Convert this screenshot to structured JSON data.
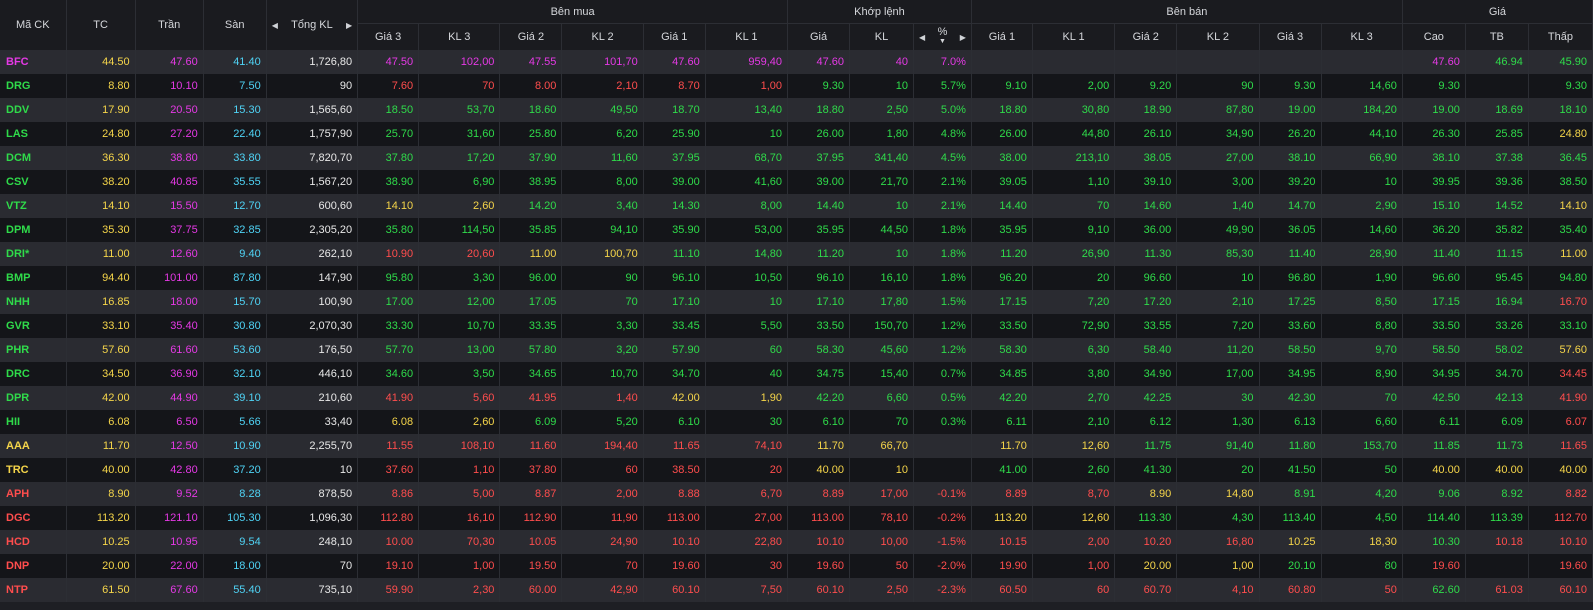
{
  "header": {
    "symbol": "Mã CK",
    "tc": "TC",
    "tran": "Trần",
    "san": "Sàn",
    "total": "Tổng KL",
    "buy_group": "Bên mua",
    "match_group": "Khớp lệnh",
    "sell_group": "Bên bán",
    "price_group": "Giá",
    "bid3_price": "Giá 3",
    "bid3_vol": "KL 3",
    "bid2_price": "Giá 2",
    "bid2_vol": "KL 2",
    "bid1_price": "Giá 1",
    "bid1_vol": "KL 1",
    "match_price": "Giá",
    "match_vol": "KL",
    "match_pct": "%",
    "ask1_price": "Giá 1",
    "ask1_vol": "KL 1",
    "ask2_price": "Giá 2",
    "ask2_vol": "KL 2",
    "ask3_price": "Giá 3",
    "ask3_vol": "KL 3",
    "high": "Cao",
    "avg": "TB",
    "low": "Thấp"
  },
  "colors": {
    "up": "#2fdb4a",
    "down": "#ff4d4d",
    "reference": "#f5d54a",
    "ceiling": "#e539e5",
    "floor": "#4fd3f5",
    "neutral": "#e8e8e8"
  },
  "rows": [
    {
      "c": [
        "ce",
        "ref",
        "ce",
        "fl",
        "wh",
        "ce",
        "ce",
        "ce",
        "ce",
        "ce",
        "ce",
        "ce",
        "ce",
        "ce",
        "",
        "",
        "",
        "",
        "",
        "",
        "ce",
        "up",
        "up"
      ],
      "v": [
        "BFC",
        "44.50",
        "47.60",
        "41.40",
        "1,726,80",
        "47.50",
        "102,00",
        "47.55",
        "101,70",
        "47.60",
        "959,40",
        "47.60",
        "40",
        "7.0%",
        "",
        "",
        "",
        "",
        "",
        "",
        "47.60",
        "46.94",
        "45.90"
      ]
    },
    {
      "c": [
        "up",
        "ref",
        "ce",
        "fl",
        "wh",
        "dn",
        "dn",
        "dn",
        "dn",
        "dn",
        "dn",
        "up",
        "up",
        "up",
        "up",
        "up",
        "up",
        "up",
        "up",
        "up",
        "up",
        "",
        "up"
      ],
      "v": [
        "DRG",
        "8.80",
        "10.10",
        "7.50",
        "90",
        "7.60",
        "70",
        "8.00",
        "2,10",
        "8.70",
        "1,00",
        "9.30",
        "10",
        "5.7%",
        "9.10",
        "2,00",
        "9.20",
        "90",
        "9.30",
        "14,60",
        "9.30",
        "",
        "9.30"
      ]
    },
    {
      "c": [
        "up",
        "ref",
        "ce",
        "fl",
        "wh",
        "up",
        "up",
        "up",
        "up",
        "up",
        "up",
        "up",
        "up",
        "up",
        "up",
        "up",
        "up",
        "up",
        "up",
        "up",
        "up",
        "up",
        "up"
      ],
      "v": [
        "DDV",
        "17.90",
        "20.50",
        "15.30",
        "1,565,60",
        "18.50",
        "53,70",
        "18.60",
        "49,50",
        "18.70",
        "13,40",
        "18.80",
        "2,50",
        "5.0%",
        "18.80",
        "30,80",
        "18.90",
        "87,80",
        "19.00",
        "184,20",
        "19.00",
        "18.69",
        "18.10"
      ]
    },
    {
      "c": [
        "up",
        "ref",
        "ce",
        "fl",
        "wh",
        "up",
        "up",
        "up",
        "up",
        "up",
        "up",
        "up",
        "up",
        "up",
        "up",
        "up",
        "up",
        "up",
        "up",
        "up",
        "up",
        "up",
        "ref"
      ],
      "v": [
        "LAS",
        "24.80",
        "27.20",
        "22.40",
        "1,757,90",
        "25.70",
        "31,60",
        "25.80",
        "6,20",
        "25.90",
        "10",
        "26.00",
        "1,80",
        "4.8%",
        "26.00",
        "44,80",
        "26.10",
        "34,90",
        "26.20",
        "44,10",
        "26.30",
        "25.85",
        "24.80"
      ]
    },
    {
      "c": [
        "up",
        "ref",
        "ce",
        "fl",
        "wh",
        "up",
        "up",
        "up",
        "up",
        "up",
        "up",
        "up",
        "up",
        "up",
        "up",
        "up",
        "up",
        "up",
        "up",
        "up",
        "up",
        "up",
        "up"
      ],
      "v": [
        "DCM",
        "36.30",
        "38.80",
        "33.80",
        "7,820,70",
        "37.80",
        "17,20",
        "37.90",
        "11,60",
        "37.95",
        "68,70",
        "37.95",
        "341,40",
        "4.5%",
        "38.00",
        "213,10",
        "38.05",
        "27,00",
        "38.10",
        "66,90",
        "38.10",
        "37.38",
        "36.45"
      ]
    },
    {
      "c": [
        "up",
        "ref",
        "ce",
        "fl",
        "wh",
        "up",
        "up",
        "up",
        "up",
        "up",
        "up",
        "up",
        "up",
        "up",
        "up",
        "up",
        "up",
        "up",
        "up",
        "up",
        "up",
        "up",
        "up"
      ],
      "v": [
        "CSV",
        "38.20",
        "40.85",
        "35.55",
        "1,567,20",
        "38.90",
        "6,90",
        "38.95",
        "8,00",
        "39.00",
        "41,60",
        "39.00",
        "21,70",
        "2.1%",
        "39.05",
        "1,10",
        "39.10",
        "3,00",
        "39.20",
        "10",
        "39.95",
        "39.36",
        "38.50"
      ]
    },
    {
      "c": [
        "up",
        "ref",
        "ce",
        "fl",
        "wh",
        "ref",
        "ref",
        "up",
        "up",
        "up",
        "up",
        "up",
        "up",
        "up",
        "up",
        "up",
        "up",
        "up",
        "up",
        "up",
        "up",
        "up",
        "ref"
      ],
      "v": [
        "VTZ",
        "14.10",
        "15.50",
        "12.70",
        "600,60",
        "14.10",
        "2,60",
        "14.20",
        "3,40",
        "14.30",
        "8,00",
        "14.40",
        "10",
        "2.1%",
        "14.40",
        "70",
        "14.60",
        "1,40",
        "14.70",
        "2,90",
        "15.10",
        "14.52",
        "14.10"
      ]
    },
    {
      "c": [
        "up",
        "ref",
        "ce",
        "fl",
        "wh",
        "up",
        "up",
        "up",
        "up",
        "up",
        "up",
        "up",
        "up",
        "up",
        "up",
        "up",
        "up",
        "up",
        "up",
        "up",
        "up",
        "up",
        "up"
      ],
      "v": [
        "DPM",
        "35.30",
        "37.75",
        "32.85",
        "2,305,20",
        "35.80",
        "114,50",
        "35.85",
        "94,10",
        "35.90",
        "53,00",
        "35.95",
        "44,50",
        "1.8%",
        "35.95",
        "9,10",
        "36.00",
        "49,90",
        "36.05",
        "14,60",
        "36.20",
        "35.82",
        "35.40"
      ]
    },
    {
      "c": [
        "up",
        "ref",
        "ce",
        "fl",
        "wh",
        "dn",
        "dn",
        "ref",
        "ref",
        "up",
        "up",
        "up",
        "up",
        "up",
        "up",
        "up",
        "up",
        "up",
        "up",
        "up",
        "up",
        "up",
        "ref"
      ],
      "v": [
        "DRI*",
        "11.00",
        "12.60",
        "9.40",
        "262,10",
        "10.90",
        "20,60",
        "11.00",
        "100,70",
        "11.10",
        "14,80",
        "11.20",
        "10",
        "1.8%",
        "11.20",
        "26,90",
        "11.30",
        "85,30",
        "11.40",
        "28,90",
        "11.40",
        "11.15",
        "11.00"
      ]
    },
    {
      "c": [
        "up",
        "ref",
        "ce",
        "fl",
        "wh",
        "up",
        "up",
        "up",
        "up",
        "up",
        "up",
        "up",
        "up",
        "up",
        "up",
        "up",
        "up",
        "up",
        "up",
        "up",
        "up",
        "up",
        "up"
      ],
      "v": [
        "BMP",
        "94.40",
        "101.00",
        "87.80",
        "147,90",
        "95.80",
        "3,30",
        "96.00",
        "90",
        "96.10",
        "10,50",
        "96.10",
        "16,10",
        "1.8%",
        "96.20",
        "20",
        "96.60",
        "10",
        "96.80",
        "1,90",
        "96.60",
        "95.45",
        "94.80"
      ]
    },
    {
      "c": [
        "up",
        "ref",
        "ce",
        "fl",
        "wh",
        "up",
        "up",
        "up",
        "up",
        "up",
        "up",
        "up",
        "up",
        "up",
        "up",
        "up",
        "up",
        "up",
        "up",
        "up",
        "up",
        "up",
        "dn"
      ],
      "v": [
        "NHH",
        "16.85",
        "18.00",
        "15.70",
        "100,90",
        "17.00",
        "12,00",
        "17.05",
        "70",
        "17.10",
        "10",
        "17.10",
        "17,80",
        "1.5%",
        "17.15",
        "7,20",
        "17.20",
        "2,10",
        "17.25",
        "8,50",
        "17.15",
        "16.94",
        "16.70"
      ]
    },
    {
      "c": [
        "up",
        "ref",
        "ce",
        "fl",
        "wh",
        "up",
        "up",
        "up",
        "up",
        "up",
        "up",
        "up",
        "up",
        "up",
        "up",
        "up",
        "up",
        "up",
        "up",
        "up",
        "up",
        "up",
        "up"
      ],
      "v": [
        "GVR",
        "33.10",
        "35.40",
        "30.80",
        "2,070,30",
        "33.30",
        "10,70",
        "33.35",
        "3,30",
        "33.45",
        "5,50",
        "33.50",
        "150,70",
        "1.2%",
        "33.50",
        "72,90",
        "33.55",
        "7,20",
        "33.60",
        "8,80",
        "33.50",
        "33.26",
        "33.10"
      ]
    },
    {
      "c": [
        "up",
        "ref",
        "ce",
        "fl",
        "wh",
        "up",
        "up",
        "up",
        "up",
        "up",
        "up",
        "up",
        "up",
        "up",
        "up",
        "up",
        "up",
        "up",
        "up",
        "up",
        "up",
        "up",
        "ref"
      ],
      "v": [
        "PHR",
        "57.60",
        "61.60",
        "53.60",
        "176,50",
        "57.70",
        "13,00",
        "57.80",
        "3,20",
        "57.90",
        "60",
        "58.30",
        "45,60",
        "1.2%",
        "58.30",
        "6,30",
        "58.40",
        "11,20",
        "58.50",
        "9,70",
        "58.50",
        "58.02",
        "57.60"
      ]
    },
    {
      "c": [
        "up",
        "ref",
        "ce",
        "fl",
        "wh",
        "up",
        "up",
        "up",
        "up",
        "up",
        "up",
        "up",
        "up",
        "up",
        "up",
        "up",
        "up",
        "up",
        "up",
        "up",
        "up",
        "up",
        "dn"
      ],
      "v": [
        "DRC",
        "34.50",
        "36.90",
        "32.10",
        "446,10",
        "34.60",
        "3,50",
        "34.65",
        "10,70",
        "34.70",
        "40",
        "34.75",
        "15,40",
        "0.7%",
        "34.85",
        "3,80",
        "34.90",
        "17,00",
        "34.95",
        "8,90",
        "34.95",
        "34.70",
        "34.45"
      ]
    },
    {
      "c": [
        "up",
        "ref",
        "ce",
        "fl",
        "wh",
        "dn",
        "dn",
        "dn",
        "dn",
        "ref",
        "ref",
        "up",
        "up",
        "up",
        "up",
        "up",
        "up",
        "up",
        "up",
        "up",
        "up",
        "up",
        "dn"
      ],
      "v": [
        "DPR",
        "42.00",
        "44.90",
        "39.10",
        "210,60",
        "41.90",
        "5,60",
        "41.95",
        "1,40",
        "42.00",
        "1,90",
        "42.20",
        "6,60",
        "0.5%",
        "42.20",
        "2,70",
        "42.25",
        "30",
        "42.30",
        "70",
        "42.50",
        "42.13",
        "41.90"
      ]
    },
    {
      "c": [
        "up",
        "ref",
        "ce",
        "fl",
        "wh",
        "ref",
        "ref",
        "up",
        "up",
        "up",
        "up",
        "up",
        "up",
        "up",
        "up",
        "up",
        "up",
        "up",
        "up",
        "up",
        "up",
        "up",
        "dn"
      ],
      "v": [
        "HII",
        "6.08",
        "6.50",
        "5.66",
        "33,40",
        "6.08",
        "2,60",
        "6.09",
        "5,20",
        "6.10",
        "30",
        "6.10",
        "70",
        "0.3%",
        "6.11",
        "2,10",
        "6.12",
        "1,30",
        "6.13",
        "6,60",
        "6.11",
        "6.09",
        "6.07"
      ]
    },
    {
      "c": [
        "ref",
        "ref",
        "ce",
        "fl",
        "wh",
        "dn",
        "dn",
        "dn",
        "dn",
        "dn",
        "dn",
        "ref",
        "ref",
        "",
        "ref",
        "ref",
        "up",
        "up",
        "up",
        "up",
        "up",
        "up",
        "dn"
      ],
      "v": [
        "AAA",
        "11.70",
        "12.50",
        "10.90",
        "2,255,70",
        "11.55",
        "108,10",
        "11.60",
        "194,40",
        "11.65",
        "74,10",
        "11.70",
        "66,70",
        "",
        "11.70",
        "12,60",
        "11.75",
        "91,40",
        "11.80",
        "153,70",
        "11.85",
        "11.73",
        "11.65"
      ]
    },
    {
      "c": [
        "ref",
        "ref",
        "ce",
        "fl",
        "wh",
        "dn",
        "dn",
        "dn",
        "dn",
        "dn",
        "dn",
        "ref",
        "ref",
        "",
        "up",
        "up",
        "up",
        "up",
        "up",
        "up",
        "ref",
        "ref",
        "ref"
      ],
      "v": [
        "TRC",
        "40.00",
        "42.80",
        "37.20",
        "10",
        "37.60",
        "1,10",
        "37.80",
        "60",
        "38.50",
        "20",
        "40.00",
        "10",
        "",
        "41.00",
        "2,60",
        "41.30",
        "20",
        "41.50",
        "50",
        "40.00",
        "40.00",
        "40.00"
      ]
    },
    {
      "c": [
        "dn",
        "ref",
        "ce",
        "fl",
        "wh",
        "dn",
        "dn",
        "dn",
        "dn",
        "dn",
        "dn",
        "dn",
        "dn",
        "dn",
        "dn",
        "dn",
        "ref",
        "ref",
        "up",
        "up",
        "up",
        "up",
        "dn"
      ],
      "v": [
        "APH",
        "8.90",
        "9.52",
        "8.28",
        "878,50",
        "8.86",
        "5,00",
        "8.87",
        "2,00",
        "8.88",
        "6,70",
        "8.89",
        "17,00",
        "-0.1%",
        "8.89",
        "8,70",
        "8.90",
        "14,80",
        "8.91",
        "4,20",
        "9.06",
        "8.92",
        "8.82"
      ]
    },
    {
      "c": [
        "dn",
        "ref",
        "ce",
        "fl",
        "wh",
        "dn",
        "dn",
        "dn",
        "dn",
        "dn",
        "dn",
        "dn",
        "dn",
        "dn",
        "ref",
        "ref",
        "up",
        "up",
        "up",
        "up",
        "up",
        "up",
        "dn"
      ],
      "v": [
        "DGC",
        "113.20",
        "121.10",
        "105.30",
        "1,096,30",
        "112.80",
        "16,10",
        "112.90",
        "11,90",
        "113.00",
        "27,00",
        "113.00",
        "78,10",
        "-0.2%",
        "113.20",
        "12,60",
        "113.30",
        "4,30",
        "113.40",
        "4,50",
        "114.40",
        "113.39",
        "112.70"
      ]
    },
    {
      "c": [
        "dn",
        "ref",
        "ce",
        "fl",
        "wh",
        "dn",
        "dn",
        "dn",
        "dn",
        "dn",
        "dn",
        "dn",
        "dn",
        "dn",
        "dn",
        "dn",
        "dn",
        "dn",
        "ref",
        "ref",
        "up",
        "dn",
        "dn"
      ],
      "v": [
        "HCD",
        "10.25",
        "10.95",
        "9.54",
        "248,10",
        "10.00",
        "70,30",
        "10.05",
        "24,90",
        "10.10",
        "22,80",
        "10.10",
        "10,00",
        "-1.5%",
        "10.15",
        "2,00",
        "10.20",
        "16,80",
        "10.25",
        "18,30",
        "10.30",
        "10.18",
        "10.10"
      ]
    },
    {
      "c": [
        "dn",
        "ref",
        "ce",
        "fl",
        "wh",
        "dn",
        "dn",
        "dn",
        "dn",
        "dn",
        "dn",
        "dn",
        "dn",
        "dn",
        "dn",
        "dn",
        "ref",
        "ref",
        "up",
        "up",
        "dn",
        "",
        "dn"
      ],
      "v": [
        "DNP",
        "20.00",
        "22.00",
        "18.00",
        "70",
        "19.10",
        "1,00",
        "19.50",
        "70",
        "19.60",
        "30",
        "19.60",
        "50",
        "-2.0%",
        "19.90",
        "1,00",
        "20.00",
        "1,00",
        "20.10",
        "80",
        "19.60",
        "",
        "19.60"
      ]
    },
    {
      "c": [
        "dn",
        "ref",
        "ce",
        "fl",
        "wh",
        "dn",
        "dn",
        "dn",
        "dn",
        "dn",
        "dn",
        "dn",
        "dn",
        "dn",
        "dn",
        "dn",
        "dn",
        "dn",
        "dn",
        "dn",
        "up",
        "dn",
        "dn"
      ],
      "v": [
        "NTP",
        "61.50",
        "67.60",
        "55.40",
        "735,10",
        "59.90",
        "2,30",
        "60.00",
        "42,90",
        "60.10",
        "7,50",
        "60.10",
        "2,50",
        "-2.3%",
        "60.50",
        "60",
        "60.70",
        "4,10",
        "60.80",
        "50",
        "62.60",
        "61.03",
        "60.10"
      ]
    }
  ]
}
